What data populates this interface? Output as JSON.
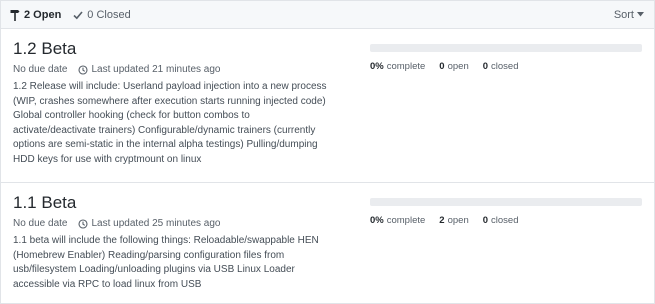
{
  "header": {
    "open_label": "2 Open",
    "closed_label": "0 Closed",
    "sort_label": "Sort"
  },
  "milestones": [
    {
      "title": "1.2 Beta",
      "due": "No due date",
      "updated": "Last updated 21 minutes ago",
      "description": "1.2 Release will include: Userland payload injection into a new process (WIP, crashes somewhere after execution starts running injected code) Global controller hooking (check for button combos to activate/deactivate trainers) Configurable/dynamic trainers (currently options are semi-static in the internal alpha testings) Pulling/dumping HDD keys for use with cryptmount on linux",
      "progress": 0,
      "complete_value": "0%",
      "complete_label": "complete",
      "open_value": "0",
      "open_label": "open",
      "closed_value": "0",
      "closed_label": "closed"
    },
    {
      "title": "1.1 Beta",
      "due": "No due date",
      "updated": "Last updated 25 minutes ago",
      "description": "1.1 beta will include the following things: Reloadable/swappable HEN (Homebrew Enabler) Reading/parsing configuration files from usb/filesystem Loading/unloading plugins via USB Linux Loader accessible via RPC to load linux from USB",
      "progress": 0,
      "complete_value": "0%",
      "complete_label": "complete",
      "open_value": "2",
      "open_label": "open",
      "closed_value": "0",
      "closed_label": "closed"
    }
  ],
  "colors": {
    "progress_fill": "#28a745",
    "progress_track": "#eaecef"
  },
  "icons": [
    "milestone-icon",
    "check-icon",
    "caret-down-icon",
    "clock-icon"
  ]
}
